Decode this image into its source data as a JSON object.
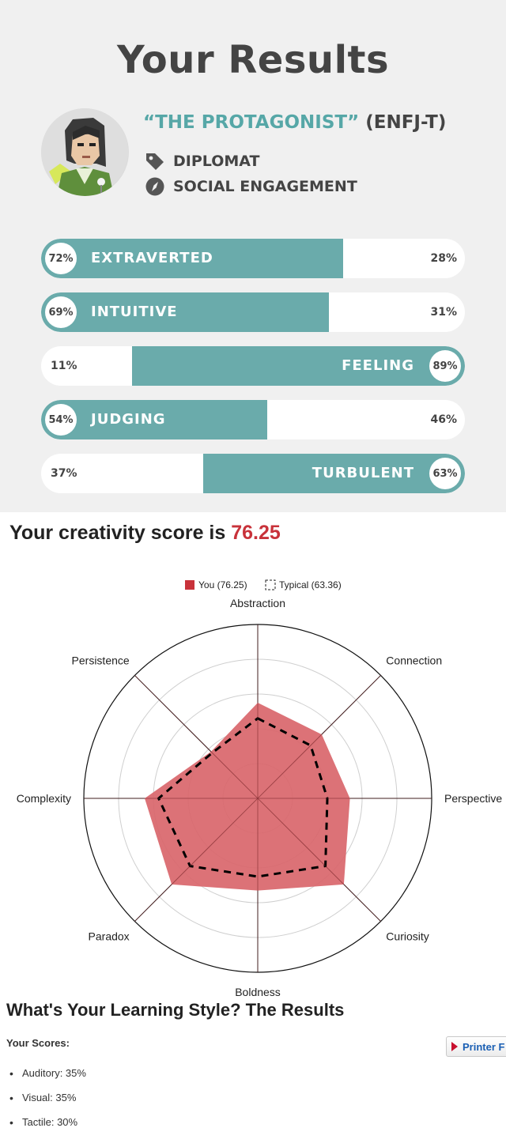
{
  "personality": {
    "title": "Your Results",
    "type_name": "“THE PROTAGONIST”",
    "type_code": "(ENFJ-T)",
    "role": "DIPLOMAT",
    "strategy": "SOCIAL ENGAGEMENT",
    "accent_color": "#6aabab",
    "traits": [
      {
        "label": "EXTRAVERTED",
        "side": "left",
        "percent": 72,
        "primary_pct": "72%",
        "opposite_pct": "28%"
      },
      {
        "label": "INTUITIVE",
        "side": "left",
        "percent": 69,
        "primary_pct": "69%",
        "opposite_pct": "31%"
      },
      {
        "label": "FEELING",
        "side": "right",
        "percent": 89,
        "primary_pct": "89%",
        "opposite_pct": "11%"
      },
      {
        "label": "JUDGING",
        "side": "left",
        "percent": 54,
        "primary_pct": "54%",
        "opposite_pct": "46%"
      },
      {
        "label": "TURBULENT",
        "side": "right",
        "percent": 63,
        "primary_pct": "63%",
        "opposite_pct": "37%"
      }
    ]
  },
  "creativity": {
    "heading_prefix": "Your creativity score is ",
    "score": "76.25",
    "score_color": "#c8323a"
  },
  "chart_data": {
    "type": "radar",
    "axes": [
      "Abstraction",
      "Connection",
      "Perspective",
      "Curiosity",
      "Boldness",
      "Paradox",
      "Complexity",
      "Persistence"
    ],
    "rlim": [
      0,
      100
    ],
    "rings": [
      20,
      40,
      60,
      80,
      100
    ],
    "legend_position": "top",
    "series": [
      {
        "name": "You (76.25)",
        "style": "filled",
        "color": "#d9666b",
        "values": [
          55,
          52,
          53,
          70,
          53,
          70,
          65,
          38
        ]
      },
      {
        "name": "Typical (63.36)",
        "style": "dashed",
        "color": "#000000",
        "values": [
          46,
          43,
          40,
          55,
          45,
          55,
          57,
          37
        ]
      }
    ]
  },
  "learning_style": {
    "title": "What's Your Learning Style? The Results",
    "scores_label": "Your Scores:",
    "printer_button": "Printer F",
    "scores": [
      {
        "label": "Auditory: 35%",
        "percent": 35
      },
      {
        "label": "Visual: 35%",
        "percent": 35
      },
      {
        "label": "Tactile: 30%",
        "percent": 30
      }
    ]
  }
}
